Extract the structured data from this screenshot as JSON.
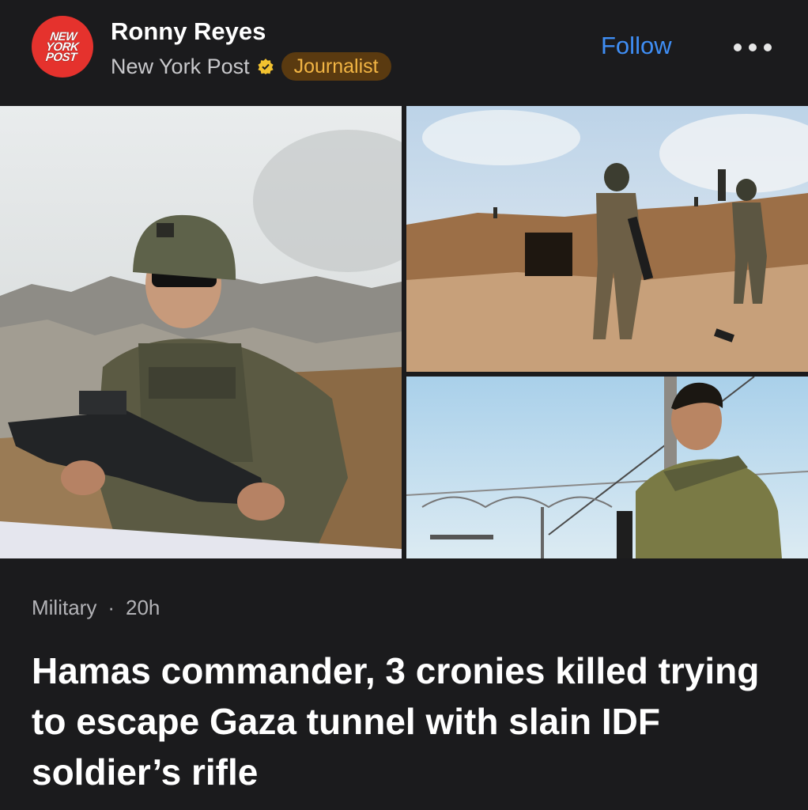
{
  "header": {
    "logo_lines": [
      "NEW",
      "YORK",
      "POST"
    ],
    "author": "Ronny Reyes",
    "publication": "New York Post",
    "badge": "Journalist",
    "follow_label": "Follow",
    "more_icon": "more-horizontal-icon",
    "verified_icon": "verified-badge-icon"
  },
  "images": [
    {
      "name": "soldier-with-rifle-photo"
    },
    {
      "name": "soldiers-at-tunnel-photo"
    },
    {
      "name": "soldier-portrait-photo"
    }
  ],
  "article": {
    "category": "Military",
    "separator": "·",
    "age": "20h",
    "headline": "Hamas commander, 3 cronies killed trying to escape Gaza tunnel with slain IDF soldier’s rifle"
  },
  "colors": {
    "background": "#1b1b1d",
    "follow": "#3f8ef5",
    "badge_bg": "#5a3a10",
    "badge_text": "#f2b544",
    "logo_red": "#e5322d"
  }
}
